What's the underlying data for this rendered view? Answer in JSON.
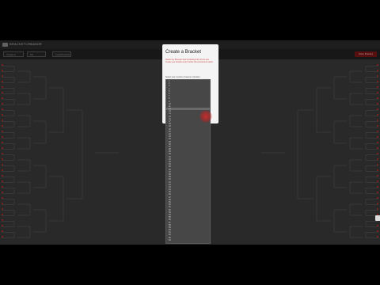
{
  "app": {
    "brand": "BRACKETCREATOR",
    "brand_sub": "Bracket"
  },
  "nav": {
    "buttons": [
      "Create a Bracket",
      "My Brackets",
      "Leaderboards"
    ],
    "cta": "Save Bracket"
  },
  "modal": {
    "title": "Create a Bracket",
    "note": "Select the 68-team field (including First Four) and create your bracket entry before the tournament starts.",
    "select_label": "Select your number of teams in bracket"
  },
  "dropdown": {
    "selected_index": 11,
    "options": [
      "1",
      "2",
      "3",
      "4",
      "5",
      "6",
      "7",
      "8",
      "9",
      "10",
      "11",
      "12",
      "13",
      "14",
      "15",
      "16",
      "17",
      "18",
      "19",
      "20",
      "21",
      "22",
      "23",
      "24",
      "25",
      "26",
      "27",
      "28",
      "29",
      "30",
      "31",
      "32",
      "33",
      "34",
      "35",
      "36",
      "37",
      "38",
      "39",
      "40",
      "41",
      "42",
      "43",
      "44",
      "45",
      "46",
      "47",
      "48",
      "49",
      "50",
      "51",
      "52",
      "53",
      "54",
      "55",
      "56",
      "57",
      "58",
      "59",
      "60",
      "61",
      "62",
      "63",
      "64"
    ]
  },
  "colors": {
    "accent_red": "#7a1616",
    "seed_red": "#b02a2a"
  }
}
